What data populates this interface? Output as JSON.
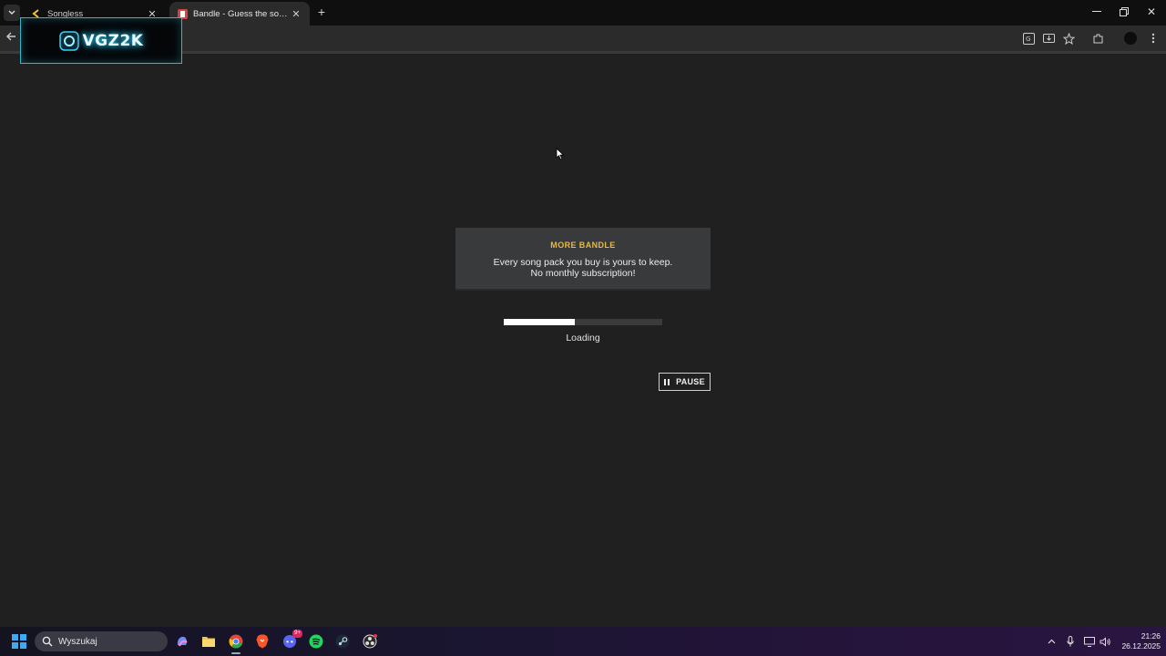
{
  "browser": {
    "tabs": [
      {
        "title": "Songless",
        "active": false
      },
      {
        "title": "Bandle - Guess the song, one instrument at a time",
        "active": true
      }
    ],
    "overlay_logo_text": "VGZ2K"
  },
  "page": {
    "promo": {
      "heading": "MORE BANDLE",
      "line1": "Every song pack you buy is yours to keep.",
      "line2": "No monthly subscription!"
    },
    "progress": {
      "fraction": 0.45
    },
    "loading_label": "Loading",
    "pause_label": "PAUSE"
  },
  "taskbar": {
    "search_placeholder": "Wyszukaj",
    "apps": [
      "copilot-icon",
      "file-explorer-icon",
      "chrome-icon",
      "brave-icon",
      "discord-icon",
      "spotify-icon",
      "steam-icon",
      "obs-icon"
    ],
    "discord_badge": "9+",
    "time": "21:26",
    "date": "26.12.2025"
  },
  "colors": {
    "background": "#202020",
    "promo_heading": "#e8b94b",
    "promo_bg": "#393a3c",
    "progress_fill": "#ffffff"
  }
}
